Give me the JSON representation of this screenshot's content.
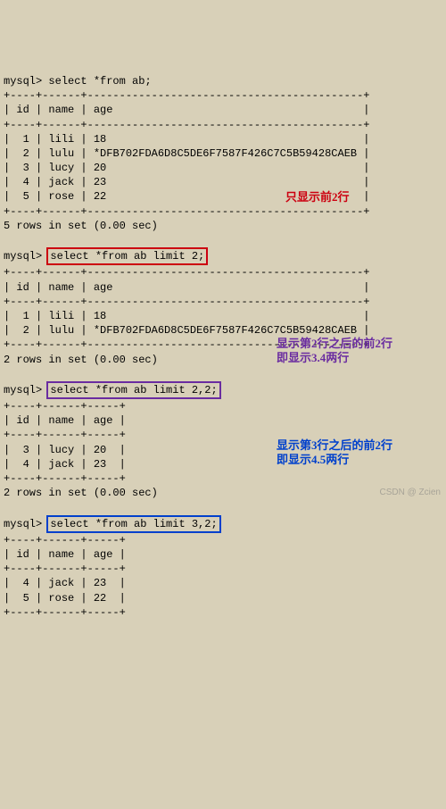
{
  "prompt": "mysql>",
  "queries": {
    "q1": "select *from ab;",
    "q2": "select *from ab limit 2;",
    "q3": "select *from ab limit 2,2;",
    "q4": "select *from ab limit 3,2;"
  },
  "columns": {
    "c1": "id",
    "c2": "name",
    "c3": "age"
  },
  "rows": {
    "r1": {
      "id": "1",
      "name": "lili",
      "age": "18"
    },
    "r2": {
      "id": "2",
      "name": "lulu",
      "age": "*DFB702FDA6D8C5DE6F7587F426C7C5B59428CAEB"
    },
    "r3": {
      "id": "3",
      "name": "lucy",
      "age": "20"
    },
    "r4": {
      "id": "4",
      "name": "jack",
      "age": "23"
    },
    "r5": {
      "id": "5",
      "name": "rose",
      "age": "22"
    }
  },
  "footers": {
    "f5": "5 rows in set (0.00 sec)",
    "f2": "2 rows in set (0.00 sec)"
  },
  "separators": {
    "wide": "+----+------+-------------------------------------------+",
    "narrow": "+----+------+-----+"
  },
  "annotations": {
    "a1": "只显示前2行",
    "a2l1": "显示第2行之后的前2行",
    "a2l2": "即显示3.4两行",
    "a3l1": "显示第3行之后的前2行",
    "a3l2": "即显示4.5两行"
  },
  "watermark": "CSDN @ Zcien",
  "chart_data": [
    {
      "type": "table",
      "query": "select *from ab;",
      "columns": [
        "id",
        "name",
        "age"
      ],
      "rows": [
        [
          1,
          "lili",
          "18"
        ],
        [
          2,
          "lulu",
          "*DFB702FDA6D8C5DE6F7587F426C7C5B59428CAEB"
        ],
        [
          3,
          "lucy",
          "20"
        ],
        [
          4,
          "jack",
          "23"
        ],
        [
          5,
          "rose",
          "22"
        ]
      ],
      "footer": "5 rows in set (0.00 sec)"
    },
    {
      "type": "table",
      "query": "select *from ab limit 2;",
      "annotation": "只显示前2行",
      "columns": [
        "id",
        "name",
        "age"
      ],
      "rows": [
        [
          1,
          "lili",
          "18"
        ],
        [
          2,
          "lulu",
          "*DFB702FDA6D8C5DE6F7587F426C7C5B59428CAEB"
        ]
      ],
      "footer": "2 rows in set (0.00 sec)"
    },
    {
      "type": "table",
      "query": "select *from ab limit 2,2;",
      "annotation": "显示第2行之后的前2行 即显示3.4两行",
      "columns": [
        "id",
        "name",
        "age"
      ],
      "rows": [
        [
          3,
          "lucy",
          "20"
        ],
        [
          4,
          "jack",
          "23"
        ]
      ],
      "footer": "2 rows in set (0.00 sec)"
    },
    {
      "type": "table",
      "query": "select *from ab limit 3,2;",
      "annotation": "显示第3行之后的前2行 即显示4.5两行",
      "columns": [
        "id",
        "name",
        "age"
      ],
      "rows": [
        [
          4,
          "jack",
          "23"
        ],
        [
          5,
          "rose",
          "22"
        ]
      ]
    }
  ]
}
